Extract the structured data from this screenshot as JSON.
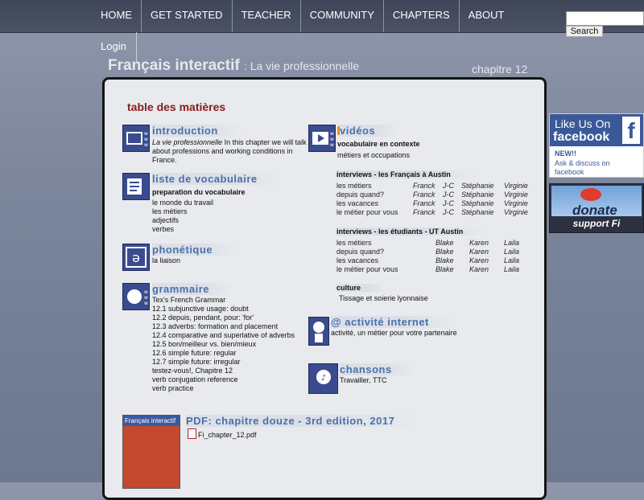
{
  "nav": {
    "items": [
      "HOME",
      "GET STARTED",
      "TEACHER",
      "COMMUNITY",
      "CHAPTERS",
      "ABOUT"
    ],
    "login": "Login",
    "search_button": "Search"
  },
  "header": {
    "title": "Français interactif",
    "subtitle": ": La vie professionnelle",
    "chapter": "chapitre 12"
  },
  "toc": {
    "title": "table des matières",
    "introduction": {
      "heading": "introduction",
      "title_italic": "La vie professionnelle",
      "text1": " In this chapter we will talk",
      "text2": "about professions and working conditions in",
      "text3": "France."
    },
    "vocab": {
      "heading": "liste de vocabulaire",
      "sub": "preparation du vocabulaire",
      "items": [
        "le monde du travail",
        "les métiers",
        "adjectifs",
        "verbes"
      ]
    },
    "phonetique": {
      "heading": "phonétique",
      "items": [
        "la liaison"
      ]
    },
    "grammaire": {
      "heading": "grammaire",
      "items": [
        "Tex's French Grammar",
        "12.1  subjunctive usage: doubt",
        "12.2  depuis, pendant, pour: 'for'",
        "12.3  adverbs: formation and placement",
        "12.4  comparative and superlative of adverbs",
        "12.5  bon/meilleur vs. bien/mieux",
        "12.6  simple future: regular",
        "12.7  simple future: irregular",
        "testez-vous!, Chapitre 12",
        "verb conjugation reference",
        "verb practice"
      ]
    },
    "videos": {
      "heading": "vidéos",
      "sub": "vocabulaire en contexte",
      "sub_item": "métiers et occupations",
      "francais_heading": "interviews - les Français à Austin",
      "francais_rows": [
        [
          "les métiers",
          "Franck",
          "J-C",
          "Stéphanie",
          "Virginie"
        ],
        [
          "depuis quand?",
          "Franck",
          "J-C",
          "Stéphanie",
          "Virginie"
        ],
        [
          "les vacances",
          "Franck",
          "J-C",
          "Stéphanie",
          "Virginie"
        ],
        [
          "le métier pour vous",
          "Franck",
          "J-C",
          "Stéphanie",
          "Virginie"
        ]
      ],
      "etudiants_heading": "interviews - les étudiants - UT Austin",
      "etudiants_rows": [
        [
          "les métiers",
          "Blake",
          "Karen",
          "Laila"
        ],
        [
          "depuis quand?",
          "Blake",
          "Karen",
          "Laila"
        ],
        [
          "les vacances",
          "Blake",
          "Karen",
          "Laila"
        ],
        [
          "le métier pour vous",
          "Blake",
          "Karen",
          "Laila"
        ]
      ],
      "culture_heading": "culture",
      "culture_item": "Tissage et soierie lyonnaise"
    },
    "activite": {
      "heading": "@ activité internet",
      "item": "activité, un métier pour votre partenaire"
    },
    "chansons": {
      "heading": "chansons",
      "item": "Travailler, TTC"
    },
    "pdf": {
      "heading": "PDF: chapitre douze - 3rd edition, 2017",
      "file": "Fi_chapter_12.pdf",
      "book_label": "Français interactif"
    }
  },
  "facebook": {
    "like": "Like Us On",
    "word": "facebook",
    "new": "NEW!!",
    "text1": "Ask & discuss on",
    "text2": "facebook"
  },
  "donate": {
    "word": "donate",
    "support": "support Fi"
  },
  "colors": {
    "accent_heading": "#4970aa",
    "toc_title": "#8a1a1a",
    "nav_bg": "#3f4657",
    "facebook_blue": "#3b5998"
  }
}
